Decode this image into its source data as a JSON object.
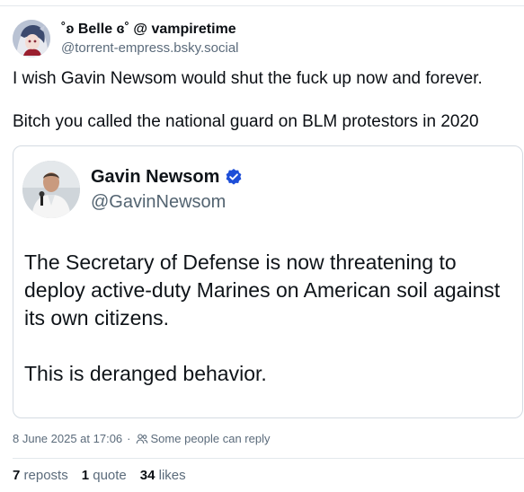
{
  "post": {
    "author": {
      "display_name": "˚ʚ Belle ɞ˚ @ vampiretime",
      "handle": "@torrent-empress.bsky.social"
    },
    "text_line1": "I wish Gavin Newsom would shut the fuck up now and forever.",
    "text_line2": "Bitch you called the national guard on BLM protestors in 2020"
  },
  "embed": {
    "name": "Gavin Newsom",
    "handle": "@GavinNewsom",
    "body_para1": "The Secretary of Defense is now threatening to deploy active-duty Marines on American soil against its own citizens.",
    "body_para2": "This is deranged behavior.",
    "verified_color": "#1d4ed8"
  },
  "meta": {
    "timestamp": "8 June 2025 at 17:06",
    "separator": "·",
    "reply_setting": "Some people can reply"
  },
  "stats": {
    "reposts_count": "7",
    "reposts_label": "reposts",
    "quotes_count": "1",
    "quotes_label": "quote",
    "likes_count": "34",
    "likes_label": "likes"
  },
  "colors": {
    "text": "#0b0f14",
    "muted": "#5b6b7b",
    "border": "#d4dbe2"
  }
}
